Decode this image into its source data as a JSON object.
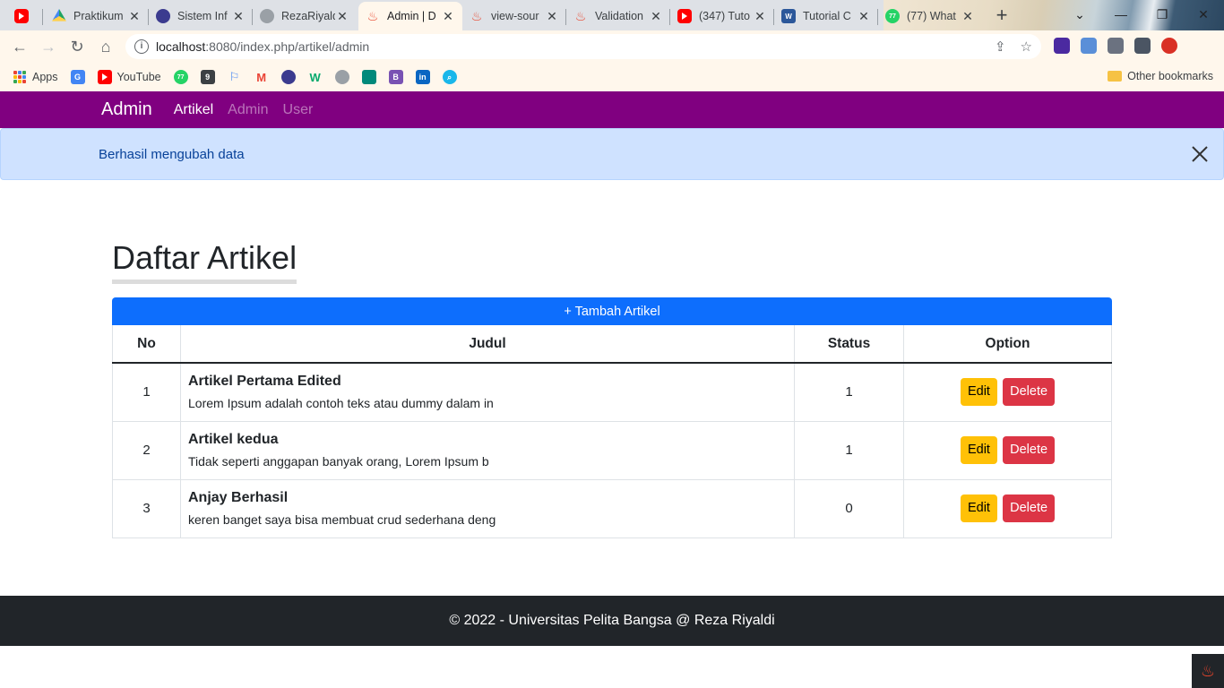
{
  "browser": {
    "tabs": [
      {
        "title": "",
        "icon": "youtube-icon"
      },
      {
        "title": "Praktikum",
        "icon": "google-drive-icon"
      },
      {
        "title": "Sistem Inf",
        "icon": "university-icon"
      },
      {
        "title": "RezaRiyald",
        "icon": "github-icon"
      },
      {
        "title": "Admin | D",
        "icon": "codeigniter-icon"
      },
      {
        "title": "view-sour",
        "icon": "codeigniter-icon"
      },
      {
        "title": "Validation",
        "icon": "codeigniter-icon"
      },
      {
        "title": "(347) Tuto",
        "icon": "youtube-icon"
      },
      {
        "title": "Tutorial C",
        "icon": "word-icon"
      },
      {
        "title": "(77) What",
        "icon": "whatsapp-icon"
      }
    ],
    "url_host": "localhost",
    "url_path": ":8080/index.php/artikel/admin",
    "bookmarks": [
      {
        "label": "Apps",
        "icon": "apps-icon"
      },
      {
        "label": "",
        "icon": "google-translate-icon"
      },
      {
        "label": "YouTube",
        "icon": "youtube-icon"
      },
      {
        "label": "",
        "icon": "whatsapp-icon"
      },
      {
        "label": "",
        "icon": "github-desktop-icon"
      },
      {
        "label": "",
        "icon": "flag-icon"
      },
      {
        "label": "",
        "icon": "gmail-icon"
      },
      {
        "label": "",
        "icon": "university-icon"
      },
      {
        "label": "",
        "icon": "w3schools-icon"
      },
      {
        "label": "",
        "icon": "github-icon"
      },
      {
        "label": "",
        "icon": "google-meet-icon"
      },
      {
        "label": "",
        "icon": "bootstrap-icon"
      },
      {
        "label": "",
        "icon": "linkedin-icon"
      },
      {
        "label": "",
        "icon": "search-icon"
      }
    ],
    "other_bookmarks": "Other bookmarks"
  },
  "navbar": {
    "brand": "Admin",
    "links": [
      {
        "label": "Artikel",
        "active": true
      },
      {
        "label": "Admin",
        "active": false
      },
      {
        "label": "User",
        "active": false
      }
    ],
    "color": "#800080"
  },
  "alert": {
    "message": "Berhasil mengubah data"
  },
  "main": {
    "title": "Daftar Artikel",
    "add_button": "+ Tambah Artikel",
    "table": {
      "headers": [
        "No",
        "Judul",
        "Status",
        "Option"
      ],
      "rows": [
        {
          "no": "1",
          "title": "Artikel Pertama Edited",
          "excerpt": "Lorem Ipsum adalah contoh teks atau dummy dalam in",
          "status": "1"
        },
        {
          "no": "2",
          "title": "Artikel kedua",
          "excerpt": "Tidak seperti anggapan banyak orang, Lorem Ipsum b",
          "status": "1"
        },
        {
          "no": "3",
          "title": "Anjay Berhasil",
          "excerpt": "keren banget saya bisa membuat crud sederhana deng",
          "status": "0"
        }
      ],
      "edit_label": "Edit",
      "delete_label": "Delete"
    }
  },
  "footer": {
    "text": "© 2022 - Universitas Pelita Bangsa @ Reza Riyaldi"
  }
}
